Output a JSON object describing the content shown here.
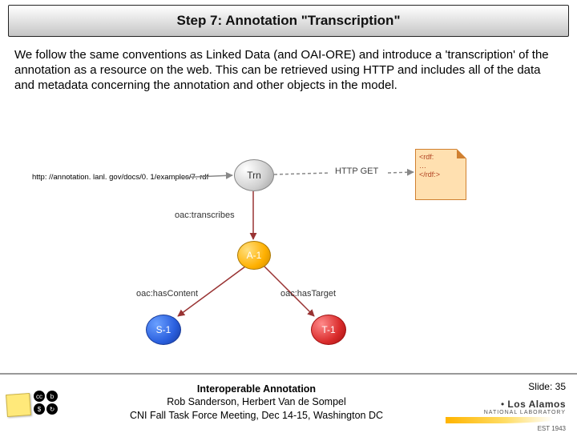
{
  "title": "Step 7: Annotation \"Transcription\"",
  "body": "We follow the same conventions as Linked Data (and OAI-ORE) and introduce a 'transcription' of the annotation as a resource on the web.  This can be retrieved using HTTP and includes all of the data and metadata concerning the annotation and other objects in the model.",
  "diagram": {
    "url": "http: //annotation. lanl. gov/docs/0. 1/examples/7. rdf",
    "http_label": "HTTP GET",
    "rdf_text_top": "<rdf:",
    "rdf_text_mid": "…",
    "rdf_text_bot": "</rdf:>",
    "nodes": {
      "trn": "Trn",
      "a1": "A-1",
      "s1": "S-1",
      "t1": "T-1"
    },
    "edges": {
      "transcribes": "oac:transcribes",
      "hasContent": "oac:hasContent",
      "hasTarget": "oac:hasTarget"
    }
  },
  "footer": {
    "line1": "Interoperable Annotation",
    "line2": "Rob Sanderson, Herbert Van de Sompel",
    "line3": "CNI Fall Task Force Meeting, Dec 14-15, Washington DC",
    "slide": "Slide: 35",
    "lanl_top": "Los Alamos",
    "lanl_sub": "NATIONAL LABORATORY",
    "lanl_est": "EST 1943"
  }
}
